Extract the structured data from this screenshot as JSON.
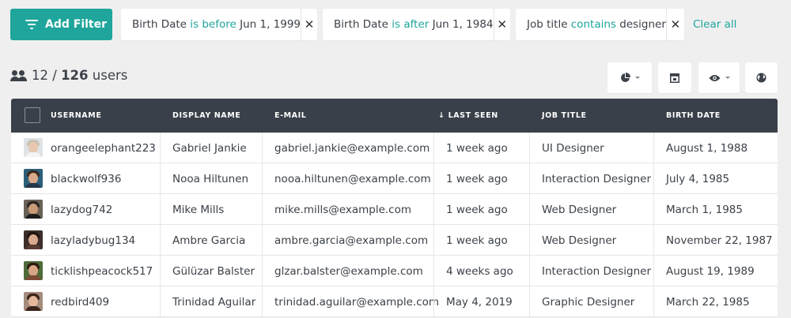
{
  "toolbar": {
    "add_filter_label": "Add Filter",
    "clear_all_label": "Clear all"
  },
  "filters": [
    {
      "field": "Birth Date",
      "operator": "is before",
      "value": "Jun 1, 1999"
    },
    {
      "field": "Birth Date",
      "operator": "is after",
      "value": "Jun 1, 1984"
    },
    {
      "field": "Job title",
      "operator": "contains",
      "value": "designer"
    }
  ],
  "close_glyph": "✕",
  "count": {
    "shown": "12",
    "separator": "/",
    "total": "126",
    "unit": "users"
  },
  "tool_buttons": [
    {
      "name": "chart-view-button",
      "icon": "pie-chart-icon",
      "has_caret": true
    },
    {
      "name": "layout-button",
      "icon": "layout-icon",
      "has_caret": false
    },
    {
      "name": "visibility-button",
      "icon": "eye-icon",
      "has_caret": true
    },
    {
      "name": "globe-button",
      "icon": "globe-icon",
      "has_caret": false
    }
  ],
  "table": {
    "columns": [
      {
        "label": "USERNAME"
      },
      {
        "label": "DISPLAY NAME"
      },
      {
        "label": "E-MAIL"
      },
      {
        "label": "LAST SEEN",
        "sort_glyph": "↓"
      },
      {
        "label": "JOB TITLE"
      },
      {
        "label": "BIRTH DATE"
      }
    ],
    "rows": [
      {
        "username": "orangeelephant223",
        "display_name": "Gabriel Jankie",
        "email": "gabriel.jankie@example.com",
        "last_seen": "1 week ago",
        "job_title": "UI Designer",
        "birth_date": "August 1, 1988"
      },
      {
        "username": "blackwolf936",
        "display_name": "Nooa Hiltunen",
        "email": "nooa.hiltunen@example.com",
        "last_seen": "1 week ago",
        "job_title": "Interaction Designer",
        "birth_date": "July 4, 1985"
      },
      {
        "username": "lazydog742",
        "display_name": "Mike Mills",
        "email": "mike.mills@example.com",
        "last_seen": "1 week ago",
        "job_title": "Web Designer",
        "birth_date": "March 1, 1985"
      },
      {
        "username": "lazyladybug134",
        "display_name": "Ambre Garcia",
        "email": "ambre.garcia@example.com",
        "last_seen": "1 week ago",
        "job_title": "Web Designer",
        "birth_date": "November 22, 1987"
      },
      {
        "username": "ticklishpeacock517",
        "display_name": "Gülüzar Balster",
        "email": "glzar.balster@example.com",
        "last_seen": "4 weeks ago",
        "job_title": "Interaction Designer",
        "birth_date": "August 19, 1989"
      },
      {
        "username": "redbird409",
        "display_name": "Trinidad Aguilar",
        "email": "trinidad.aguilar@example.com",
        "last_seen": "May 4, 2019",
        "job_title": "Graphic Designer",
        "birth_date": "March 22, 1985"
      }
    ]
  },
  "colors": {
    "accent": "#1fa59c",
    "header_bg": "#3a4049",
    "page_bg": "#efefef",
    "text": "#3b4148"
  }
}
